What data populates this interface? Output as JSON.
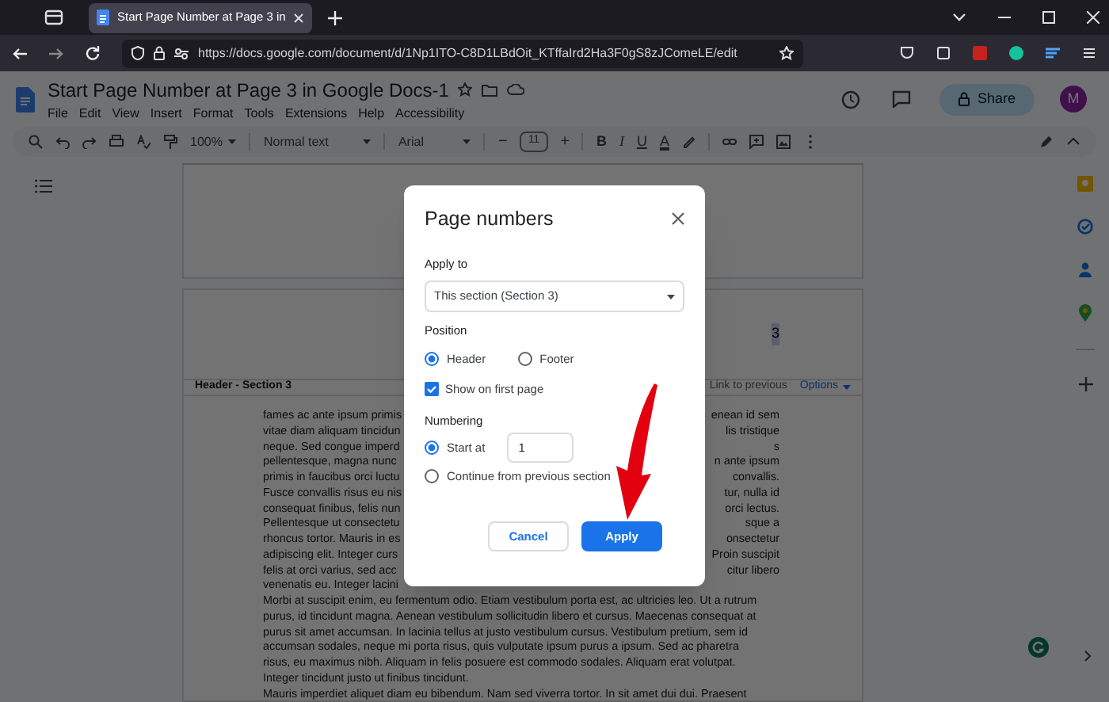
{
  "browser": {
    "tabs": [
      {
        "title": "Start Page Number at Page 3 in",
        "selected": true
      }
    ],
    "url": "https://docs.google.com/document/d/1Np1ITO-C8D1LBdOit_KTffaIrd2Ha3F0gS8zJComeLE/edit"
  },
  "docs": {
    "title": "Start Page Number at Page 3 in Google Docs-1",
    "menu": [
      "File",
      "Edit",
      "View",
      "Insert",
      "Format",
      "Tools",
      "Extensions",
      "Help",
      "Accessibility"
    ],
    "share": "Share",
    "avatar": "M",
    "toolbar": {
      "zoom": "100%",
      "style": "Normal text",
      "font": "Arial",
      "minus": "−",
      "size": "11",
      "plus": "+",
      "format": [
        "B",
        "I",
        "U",
        "A"
      ]
    }
  },
  "document": {
    "page_number": "3",
    "header_label": "Header - Section 3",
    "link_to_previous": "Link to previous",
    "options": "Options",
    "covered_lines": [
      {
        "left": "fames ac ante ipsum primis",
        "right": "enean id sem"
      },
      {
        "left": "vitae diam aliquam tincidun",
        "right": "lis tristique"
      },
      {
        "left": "neque. Sed congue imperd",
        "right": "s"
      },
      {
        "left": "pellentesque, magna nunc",
        "right": "n ante ipsum"
      },
      {
        "left": "primis in faucibus orci luctu",
        "right": "convallis."
      },
      {
        "left": "Fusce convallis risus eu nis",
        "right": "tur, nulla id"
      },
      {
        "left": "consequat finibus, felis nun",
        "right": "orci lectus."
      },
      {
        "left": "Pellentesque ut consectetu",
        "right": "sque a"
      },
      {
        "left": "rhoncus tortor. Mauris in es",
        "right": "onsectetur"
      },
      {
        "left": "adipiscing elit. Integer curs",
        "right": "Proin suscipit"
      },
      {
        "left": "felis at orci varius, sed acc",
        "right": "citur libero"
      },
      {
        "left": "venenatis eu. Integer lacini"
      }
    ],
    "lines": [
      "Morbi at suscipit enim, eu fermentum odio. Etiam vestibulum porta est, ac ultricies leo. Ut a rutrum",
      "purus, id tincidunt magna. Aenean vestibulum sollicitudin libero et cursus. Maecenas consequat at",
      "purus sit amet accumsan. In lacinia tellus at justo vestibulum cursus. Vestibulum pretium, sem id",
      "accumsan sodales, neque mi porta risus, quis vulputate ipsum purus a ipsum. Sed ac pharetra",
      "risus, eu maximus nibh. Aliquam in felis posuere est commodo sodales. Aliquam erat volutpat.",
      "Integer tincidunt justo ut finibus tincidunt.",
      "Mauris imperdiet aliquet diam eu bibendum. Nam sed viverra tortor. In sit amet dui dui. Praesent"
    ]
  },
  "dialog": {
    "title": "Page numbers",
    "apply_to_label": "Apply to",
    "apply_to_value": "This section (Section 3)",
    "position_label": "Position",
    "position_options": [
      {
        "label": "Header",
        "selected": true
      },
      {
        "label": "Footer",
        "selected": false
      }
    ],
    "show_on_first_page": {
      "label": "Show on first page",
      "checked": true
    },
    "numbering_label": "Numbering",
    "numbering_options": [
      {
        "kind": "input",
        "label": "Start at",
        "value": "1",
        "selected": true
      },
      {
        "kind": "plain",
        "label": "Continue from previous section",
        "selected": false
      }
    ],
    "buttons": [
      {
        "kind": "secondary",
        "label": "Cancel"
      },
      {
        "kind": "primary",
        "label": "Apply"
      }
    ]
  }
}
